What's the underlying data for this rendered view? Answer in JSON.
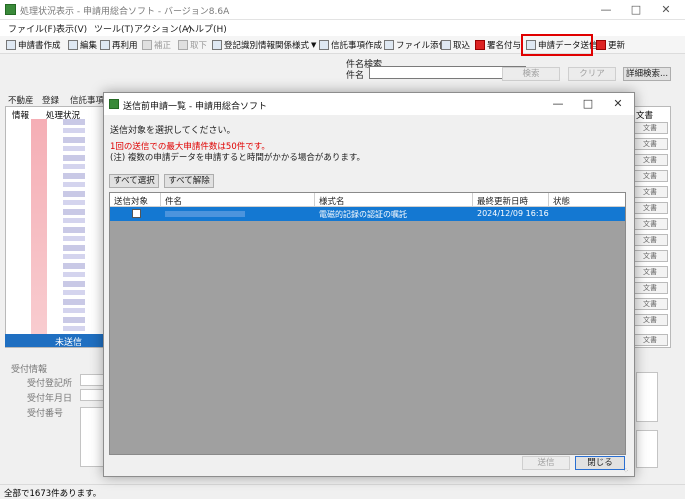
{
  "window": {
    "title": "処理状況表示 - 申請用総合ソフト - バージョン8.6A"
  },
  "menu": [
    "ファイル(F)",
    "表示(V)",
    "ツール(T)",
    "アクション(A)",
    "ヘルプ(H)"
  ],
  "toolbar": {
    "items": [
      "申請書作成",
      "編集",
      "再利用",
      "補正",
      "取下",
      "登記識別情報関係様式",
      "信託事項作成",
      "ファイル添付",
      "取込",
      "署名付与",
      "申請データ送信",
      "更新"
    ]
  },
  "search": {
    "section_label": "件名検索",
    "field_label": "件名",
    "search_button": "検索",
    "clear_button": "クリア",
    "detail_button": "詳細検索..."
  },
  "bg_tabs": [
    "不動産",
    "登録",
    "信託事項"
  ],
  "bg_list": {
    "headers": [
      "情報",
      "処理状況"
    ],
    "selected_status": "未送信"
  },
  "right_col": {
    "header": "文書",
    "cell_text": "文書"
  },
  "lower_panel": {
    "section": "受付情報",
    "fields": [
      "受付登記所",
      "受付年月日",
      "受付番号"
    ]
  },
  "status": {
    "text": "全部で1673件あります。"
  },
  "dialog": {
    "title": "送信前申請一覧 - 申請用総合ソフト",
    "instruction": "送信対象を選択してください。",
    "warning": "1回の送信での最大申請件数は50件です。",
    "note": "(注) 複数の申請データを申請すると時間がかかる場合があります。",
    "select_all": "すべて選択",
    "deselect_all": "すべて解除",
    "columns": [
      "送信対象",
      "件名",
      "様式名",
      "最終更新日時",
      "状態"
    ],
    "rows": [
      {
        "form_name": "電磁的記録の認証の嘱託",
        "updated": "2024/12/09 16:16",
        "status": ""
      }
    ],
    "send_button": "送信",
    "close_button": "閉じる"
  },
  "colors": {
    "highlight": "#e00000",
    "selection": "#1478d2"
  }
}
